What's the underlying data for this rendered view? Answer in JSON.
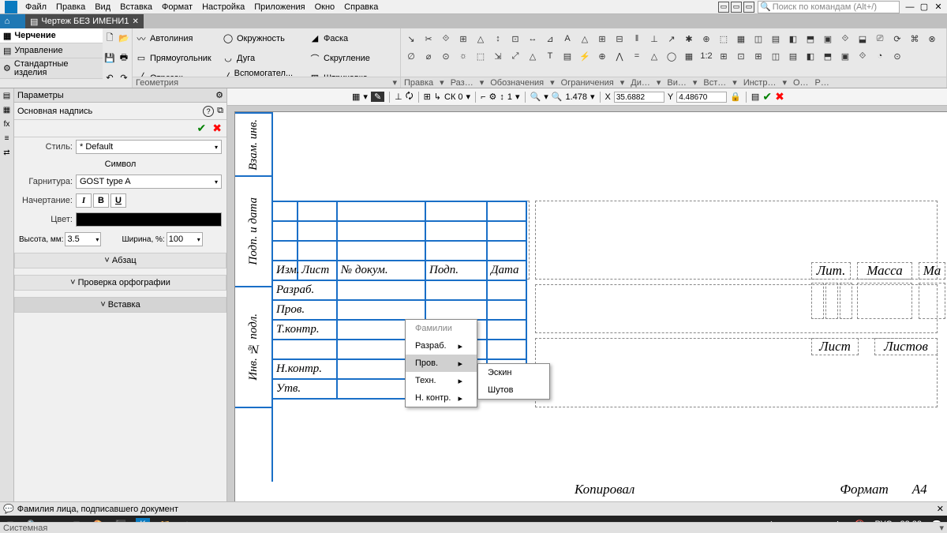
{
  "menu": {
    "items": [
      "Файл",
      "Правка",
      "Вид",
      "Вставка",
      "Формат",
      "Настройка",
      "Приложения",
      "Окно",
      "Справка"
    ],
    "search_placeholder": "Поиск по командам (Alt+/)"
  },
  "tabs": {
    "doc": "Чертеж БЕЗ ИМЕНИ1"
  },
  "ribbon_left": {
    "modes": [
      "Черчение",
      "Управление",
      "Стандартные изделия"
    ],
    "sys": "Системная"
  },
  "ribbon": {
    "tools": [
      "Автолиния",
      "Прямоугольник",
      "Отрезок",
      "Окружность",
      "Дуга",
      "Вспомогател... прямая",
      "Фаска",
      "Скругление",
      "Штриховка"
    ],
    "groups": [
      "Геометрия",
      "Правка",
      "Раз…",
      "Обозначения",
      "Ограничения",
      "Ди…",
      "Ви…",
      "Вст…",
      "Инстр…",
      "О…",
      "Р…"
    ]
  },
  "topbar": {
    "sk": "СК 0",
    "scale": "1",
    "zoom": "1.478",
    "x": "35.6882",
    "y": "4.48670"
  },
  "side": {
    "title": "Параметры",
    "sub": "Основная надпись",
    "style_label": "Стиль:",
    "style_val": "* Default",
    "symbol": "Символ",
    "font_label": "Гарнитура:",
    "font_val": "GOST type A",
    "weight_label": "Начертание:",
    "color_label": "Цвет:",
    "h_label": "Высота, мм:",
    "h_val": "3.5",
    "w_label": "Ширина, %:",
    "w_val": "100",
    "coll1": "Абзац",
    "coll2": "Проверка орфографии",
    "coll3": "Вставка"
  },
  "stamp": {
    "headers": [
      "Изм.",
      "Лист",
      "№ докум.",
      "Подп.",
      "Дата"
    ],
    "rows": [
      "Разраб.",
      "Пров.",
      "Т.контр.",
      "",
      "Н.контр.",
      "Утв."
    ],
    "vert": [
      "Взам. инв.",
      "Подп. и дата",
      "Инв. № подл."
    ],
    "right": [
      "Лит.",
      "Масса",
      "Ма",
      "Лист",
      "Листов"
    ],
    "bottom_left": "Копировал",
    "bottom_right": "Формат",
    "fmt": "А4"
  },
  "ctx": {
    "head": "Фамилии",
    "items": [
      "Разраб.",
      "Пров.",
      "Техн.",
      "Н. контр."
    ],
    "sel": "Пров.",
    "sub": [
      "Эскин",
      "Шутов"
    ]
  },
  "status": "Фамилия лица, подписавшего документ",
  "taskbar": {
    "time": "22:22",
    "lang": "РУС"
  }
}
